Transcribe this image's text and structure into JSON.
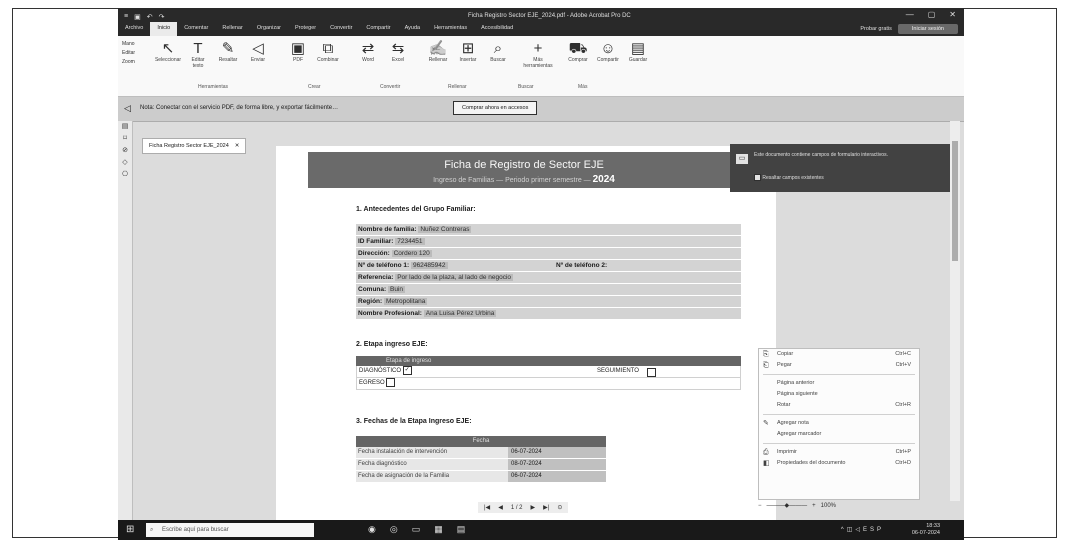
{
  "window": {
    "doc_title": "Ficha Registro Sector EJE_2024.pdf - Adobe Acrobat Pro DC",
    "controls": [
      "—",
      "▢",
      "✕"
    ]
  },
  "menubar": {
    "items": [
      "Archivo",
      "Inicio",
      "Comentar",
      "Rellenar",
      "Organizar",
      "Proteger",
      "Convertir",
      "Compartir",
      "Ayuda",
      "Herramientas",
      "Accesibilidad"
    ],
    "right_pill": "Iniciar sesión",
    "right_extra": "Probar gratis"
  },
  "ribbon": {
    "left_col": [
      "Mano",
      "Editar",
      "Zoom"
    ],
    "buttons": [
      {
        "icon": "cursor-icon",
        "glyph": "↖",
        "label": "Seleccionar"
      },
      {
        "icon": "text-icon",
        "glyph": "T",
        "label": "Editar texto"
      },
      {
        "icon": "pen-icon",
        "glyph": "✎",
        "label": "Resaltar"
      },
      {
        "icon": "share-icon",
        "glyph": "◁",
        "label": "Enviar"
      },
      {
        "icon": "pdf-icon",
        "glyph": "▣",
        "label": "PDF"
      },
      {
        "icon": "combine-icon",
        "glyph": "⧉",
        "label": "Combinar"
      },
      {
        "icon": "convert-icon",
        "glyph": "⇄",
        "label": "Word"
      },
      {
        "icon": "convert2-icon",
        "glyph": "⇆",
        "label": "Excel"
      },
      {
        "icon": "sign-icon",
        "glyph": "✍",
        "label": "Rellenar"
      },
      {
        "icon": "insert-icon",
        "glyph": "⊞",
        "label": "Insertar"
      },
      {
        "icon": "search-icon",
        "glyph": "⌕",
        "label": "Buscar"
      },
      {
        "icon": "plus-icon",
        "glyph": "+",
        "label": "Más herramientas"
      },
      {
        "icon": "cart-icon",
        "glyph": "⛟",
        "label": "Comprar"
      },
      {
        "icon": "users-icon",
        "glyph": "☺",
        "label": "Compartir"
      },
      {
        "icon": "doc-icon",
        "glyph": "▤",
        "label": "Guardar"
      }
    ],
    "group_labels": [
      "Herramientas",
      "Crear",
      "Convertir",
      "Rellenar",
      "Buscar",
      "Más"
    ]
  },
  "notification": {
    "text": "Nota: Conectar con el servicio PDF, de forma libre, y exportar fácilmente…",
    "button": "Comprar ahora en accesos"
  },
  "tab": {
    "label": "Ficha Registro Sector EJE_2024",
    "close": "✕"
  },
  "form": {
    "title": "Ficha de Registro de Sector EJE",
    "subtitle_prefix": "Ingreso de Familias — Periodo primer semestre",
    "year": "2024",
    "section1": "1. Antecedentes del Grupo Familiar:",
    "rows": [
      {
        "label": "Nombre de familia:",
        "value": "Nuñez Contreras"
      },
      {
        "label": "ID Familiar:",
        "value": "7234451"
      },
      {
        "label": "Dirección:",
        "value": "Cordero 120"
      },
      {
        "label": "Nº de teléfono 1:",
        "value": "962485942",
        "extra": "Nº de teléfono 2:"
      },
      {
        "label": "Referencia:",
        "value": "Por lado de la plaza, al lado de negocio"
      },
      {
        "label": "Comuna:",
        "value": "Buin"
      },
      {
        "label": "Región:",
        "value": "Metropolitana"
      },
      {
        "label": "Nombre Profesional:",
        "value": "Ana Luisa Pérez Urbina"
      }
    ],
    "section2": "2. Etapa ingreso EJE:",
    "etapa_header": "Etapa de ingreso",
    "etapa_row1_left": "DIAGNÓSTICO",
    "etapa_row1_right": "SEGUIMIENTO",
    "etapa_row2_left": "EGRESO",
    "section3": "3. Fechas de la Etapa Ingreso EJE:",
    "fechas_header": "Fecha",
    "fechas": [
      {
        "label": "Fecha instalación de intervención",
        "value": "06-07-2024"
      },
      {
        "label": "Fecha diagnóstico",
        "value": "08-07-2024"
      },
      {
        "label": "Fecha de asignación de la Familia",
        "value": "06-07-2024"
      }
    ]
  },
  "tooltip": {
    "text": "Este documento contiene campos de formulario interactivos.",
    "checkbox": "Resaltar campos existentes"
  },
  "context_menu": {
    "items": [
      {
        "icon": "copy-icon",
        "glyph": "⎘",
        "label": "Copiar",
        "shortcut": "Ctrl+C"
      },
      {
        "icon": "paste-icon",
        "glyph": "⎗",
        "label": "Pegar",
        "shortcut": "Ctrl+V"
      },
      {
        "icon": "",
        "glyph": "",
        "label": "Página anterior",
        "shortcut": ""
      },
      {
        "icon": "",
        "glyph": "",
        "label": "Página siguiente",
        "shortcut": ""
      },
      {
        "icon": "",
        "glyph": "",
        "label": "Rotar",
        "shortcut": "Ctrl+R"
      },
      {
        "icon": "note-icon",
        "glyph": "✎",
        "label": "Agregar nota",
        "shortcut": ""
      },
      {
        "icon": "",
        "glyph": "",
        "label": "Agregar marcador",
        "shortcut": ""
      },
      {
        "icon": "print-icon",
        "glyph": "⎙",
        "label": "Imprimir",
        "shortcut": "Ctrl+P"
      },
      {
        "icon": "props-icon",
        "glyph": "◧",
        "label": "Propiedades del documento",
        "shortcut": "Ctrl+D"
      }
    ]
  },
  "pagenav": {
    "current": "1",
    "total": "1 / 2",
    "zoom": "100%"
  },
  "taskbar": {
    "search_placeholder": "Escribe aquí para buscar",
    "lang": "ESP",
    "time": "18:33",
    "date": "06-07-2024"
  }
}
